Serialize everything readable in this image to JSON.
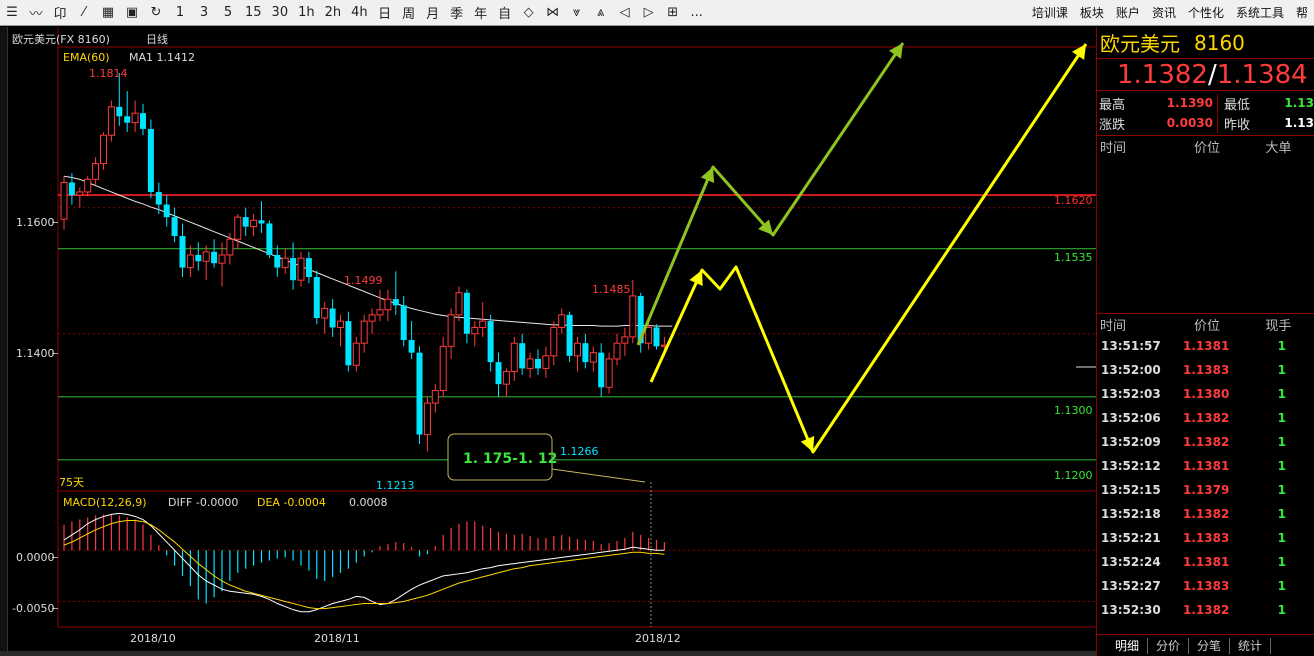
{
  "toolbar": {
    "periods": [
      "1",
      "3",
      "5",
      "15",
      "30",
      "1h",
      "2h",
      "4h",
      "日",
      "周",
      "月",
      "季",
      "年",
      "自"
    ],
    "more": "...",
    "menus": [
      "培训课",
      "板块",
      "账户",
      "资讯",
      "个性化",
      "系统工具",
      "帮"
    ]
  },
  "chart_header": {
    "instrument": "欧元美元(FX 8160)",
    "period": "日线",
    "ema": "EMA(60)",
    "ma1": "MA1 1.1412"
  },
  "macd_header": {
    "name": "MACD(12,26,9)",
    "diff": "DIFF -0.0000",
    "dea": "DEA -0.0004",
    "macd": "0.0008"
  },
  "colors": {
    "up": "#ff3b3b",
    "down": "#00e5ff",
    "ema": "#e8e8e8",
    "support": "#2ea82e",
    "resistance": "#ff2020",
    "arrow_green": "#8fc31f",
    "arrow_yellow": "#ffff00",
    "grid": "#8b0000"
  },
  "chart_data": {
    "type": "candlestick",
    "x_labels": [
      "2018/10",
      "2018/11",
      "2018/12"
    ],
    "y_ticks": [
      "1.1600",
      "1.1400"
    ],
    "macd_ticks": [
      "0.0000",
      "-0.0050"
    ],
    "price_range": [
      1.116,
      1.1855
    ],
    "candles": [
      [
        1.1582,
        1.165,
        1.1565,
        1.164
      ],
      [
        1.164,
        1.1655,
        1.1605,
        1.162
      ],
      [
        1.162,
        1.1632,
        1.16,
        1.1625
      ],
      [
        1.1625,
        1.165,
        1.1618,
        1.1645
      ],
      [
        1.1645,
        1.168,
        1.1635,
        1.167
      ],
      [
        1.167,
        1.172,
        1.166,
        1.1715
      ],
      [
        1.1715,
        1.177,
        1.1705,
        1.176
      ],
      [
        1.176,
        1.1814,
        1.173,
        1.1745
      ],
      [
        1.1745,
        1.1785,
        1.172,
        1.1735
      ],
      [
        1.1735,
        1.177,
        1.172,
        1.175
      ],
      [
        1.175,
        1.1765,
        1.1715,
        1.1725
      ],
      [
        1.1725,
        1.174,
        1.1615,
        1.1625
      ],
      [
        1.1625,
        1.164,
        1.159,
        1.1605
      ],
      [
        1.1605,
        1.162,
        1.157,
        1.1585
      ],
      [
        1.1585,
        1.16,
        1.1545,
        1.1555
      ],
      [
        1.1555,
        1.1575,
        1.149,
        1.1505
      ],
      [
        1.1505,
        1.154,
        1.149,
        1.1525
      ],
      [
        1.1525,
        1.1545,
        1.15,
        1.1515
      ],
      [
        1.1515,
        1.154,
        1.1485,
        1.153
      ],
      [
        1.153,
        1.155,
        1.1505,
        1.1512
      ],
      [
        1.1512,
        1.1545,
        1.1475,
        1.1525
      ],
      [
        1.1525,
        1.156,
        1.151,
        1.155
      ],
      [
        1.155,
        1.159,
        1.1535,
        1.1585
      ],
      [
        1.1585,
        1.16,
        1.1555,
        1.157
      ],
      [
        1.157,
        1.159,
        1.1555,
        1.158
      ],
      [
        1.158,
        1.161,
        1.156,
        1.1575
      ],
      [
        1.1575,
        1.158,
        1.152,
        1.1525
      ],
      [
        1.1525,
        1.154,
        1.149,
        1.1505
      ],
      [
        1.1505,
        1.1535,
        1.1495,
        1.152
      ],
      [
        1.152,
        1.1545,
        1.147,
        1.1485
      ],
      [
        1.1485,
        1.153,
        1.1475,
        1.152
      ],
      [
        1.152,
        1.153,
        1.148,
        1.149
      ],
      [
        1.149,
        1.15,
        1.1415,
        1.1425
      ],
      [
        1.1425,
        1.145,
        1.14,
        1.144
      ],
      [
        1.144,
        1.1455,
        1.1395,
        1.141
      ],
      [
        1.141,
        1.143,
        1.138,
        1.142
      ],
      [
        1.142,
        1.1435,
        1.134,
        1.135
      ],
      [
        1.135,
        1.1395,
        1.134,
        1.1385
      ],
      [
        1.1385,
        1.143,
        1.137,
        1.142
      ],
      [
        1.142,
        1.144,
        1.14,
        1.143
      ],
      [
        1.143,
        1.147,
        1.142,
        1.1438
      ],
      [
        1.1438,
        1.147,
        1.142,
        1.1455
      ],
      [
        1.1455,
        1.1499,
        1.143,
        1.1445
      ],
      [
        1.1445,
        1.146,
        1.138,
        1.139
      ],
      [
        1.139,
        1.142,
        1.136,
        1.137
      ],
      [
        1.137,
        1.138,
        1.1225,
        1.124
      ],
      [
        1.124,
        1.13,
        1.1213,
        1.129
      ],
      [
        1.129,
        1.132,
        1.1275,
        1.131
      ],
      [
        1.131,
        1.1395,
        1.13,
        1.138
      ],
      [
        1.138,
        1.144,
        1.136,
        1.143
      ],
      [
        1.143,
        1.1475,
        1.142,
        1.1465
      ],
      [
        1.1465,
        1.147,
        1.1385,
        1.14
      ],
      [
        1.14,
        1.142,
        1.138,
        1.141
      ],
      [
        1.141,
        1.145,
        1.1395,
        1.142
      ],
      [
        1.142,
        1.143,
        1.134,
        1.1355
      ],
      [
        1.1355,
        1.137,
        1.13,
        1.132
      ],
      [
        1.132,
        1.1345,
        1.13,
        1.134
      ],
      [
        1.134,
        1.1395,
        1.1325,
        1.1385
      ],
      [
        1.1385,
        1.14,
        1.1335,
        1.1345
      ],
      [
        1.1345,
        1.137,
        1.133,
        1.136
      ],
      [
        1.136,
        1.1375,
        1.1335,
        1.1345
      ],
      [
        1.1345,
        1.138,
        1.133,
        1.1365
      ],
      [
        1.1365,
        1.142,
        1.135,
        1.141
      ],
      [
        1.141,
        1.144,
        1.14,
        1.143
      ],
      [
        1.143,
        1.1435,
        1.1355,
        1.1365
      ],
      [
        1.1365,
        1.1395,
        1.134,
        1.1385
      ],
      [
        1.1385,
        1.14,
        1.1345,
        1.1355
      ],
      [
        1.1355,
        1.138,
        1.134,
        1.137
      ],
      [
        1.137,
        1.1385,
        1.13,
        1.1315
      ],
      [
        1.1315,
        1.137,
        1.1305,
        1.136
      ],
      [
        1.136,
        1.14,
        1.135,
        1.1385
      ],
      [
        1.1385,
        1.141,
        1.1365,
        1.1395
      ],
      [
        1.1395,
        1.1485,
        1.1385,
        1.146
      ],
      [
        1.146,
        1.1465,
        1.137,
        1.1385
      ],
      [
        1.1385,
        1.142,
        1.1375,
        1.141
      ],
      [
        1.141,
        1.1415,
        1.1375,
        1.138
      ],
      [
        1.138,
        1.1395,
        1.1365,
        1.1382
      ]
    ],
    "ema": [
      1.165,
      1.1648,
      1.1645,
      1.164,
      1.1635,
      1.163,
      1.1625,
      1.162,
      1.1615,
      1.161,
      1.1606,
      1.1601,
      1.1597,
      1.1592,
      1.1587,
      1.1582,
      1.1577,
      1.1572,
      1.1567,
      1.1562,
      1.1557,
      1.1552,
      1.1547,
      1.1542,
      1.1537,
      1.1532,
      1.1527,
      1.1522,
      1.1517,
      1.1512,
      1.1507,
      1.1502,
      1.1497,
      1.1492,
      1.1487,
      1.1482,
      1.1477,
      1.1472,
      1.1467,
      1.1462,
      1.1457,
      1.1452,
      1.1448,
      1.1444,
      1.144,
      1.1437,
      1.1434,
      1.1431,
      1.1429,
      1.1427,
      1.1426,
      1.1425,
      1.1424,
      1.1423,
      1.1422,
      1.1421,
      1.142,
      1.1419,
      1.1418,
      1.1417,
      1.1416,
      1.1415,
      1.1414,
      1.1414,
      1.1413,
      1.1413,
      1.1413,
      1.1413,
      1.1412,
      1.1412,
      1.1412,
      1.1413,
      1.1413,
      1.1413,
      1.1413,
      1.1412,
      1.1412,
      1.1412
    ],
    "levels": [
      {
        "value": 1.162,
        "label": "1.1620",
        "kind": "resistance"
      },
      {
        "value": 1.1535,
        "label": "1.1535",
        "kind": "support"
      },
      {
        "value": 1.13,
        "label": "1.1300",
        "kind": "support"
      },
      {
        "value": 1.12,
        "label": "1.1200",
        "kind": "support"
      }
    ],
    "annotations": {
      "high": "1.1814",
      "mid_high": "1.1499",
      "recent_high": "1.1485",
      "low": "1.1213",
      "recent_low": "1.1266",
      "range_box": "1. 175-1. 12",
      "days": "75天"
    },
    "macd_hist": [
      0.0025,
      0.0028,
      0.003,
      0.0032,
      0.0034,
      0.0035,
      0.0035,
      0.0034,
      0.0032,
      0.003,
      0.0025,
      0.0015,
      0.0005,
      -0.0005,
      -0.0015,
      -0.0025,
      -0.0035,
      -0.0048,
      -0.0052,
      -0.0046,
      -0.004,
      -0.003,
      -0.0022,
      -0.0018,
      -0.0015,
      -0.0012,
      -0.001,
      -0.0008,
      -0.0007,
      -0.001,
      -0.0015,
      -0.002,
      -0.0028,
      -0.003,
      -0.0026,
      -0.0022,
      -0.0018,
      -0.0012,
      -0.0006,
      -0.0002,
      0.0004,
      0.0006,
      0.0008,
      0.0007,
      0.0003,
      -0.0006,
      -0.0004,
      0.0004,
      0.0015,
      0.0022,
      0.0026,
      0.0028,
      0.0028,
      0.0024,
      0.0022,
      0.0018,
      0.0016,
      0.0015,
      0.0016,
      0.0014,
      0.0012,
      0.0012,
      0.0014,
      0.0015,
      0.0013,
      0.0011,
      0.001,
      0.0009,
      0.0006,
      0.0007,
      0.0009,
      0.0012,
      0.0018,
      0.0015,
      0.0012,
      0.001,
      0.0008
    ],
    "macd_diff": [
      0.001,
      0.0015,
      0.002,
      0.0026,
      0.003,
      0.0033,
      0.0035,
      0.0036,
      0.0035,
      0.0033,
      0.003,
      0.0024,
      0.0016,
      0.0008,
      0.0,
      -0.0008,
      -0.0016,
      -0.0024,
      -0.003,
      -0.0034,
      -0.0038,
      -0.004,
      -0.0041,
      -0.0042,
      -0.0043,
      -0.0045,
      -0.0048,
      -0.0052,
      -0.0055,
      -0.0058,
      -0.006,
      -0.006,
      -0.0058,
      -0.0055,
      -0.0052,
      -0.005,
      -0.0048,
      -0.0045,
      -0.0046,
      -0.005,
      -0.0053,
      -0.0052,
      -0.0048,
      -0.0043,
      -0.0038,
      -0.0034,
      -0.0031,
      -0.0028,
      -0.0025,
      -0.0024,
      -0.0023,
      -0.0022,
      -0.002,
      -0.0018,
      -0.0017,
      -0.0015,
      -0.0014,
      -0.0013,
      -0.0012,
      -0.0011,
      -0.001,
      -0.0009,
      -0.0008,
      -0.0007,
      -0.0006,
      -0.0005,
      -0.0004,
      -0.0003,
      -0.0002,
      -0.0001,
      0.0,
      0.0001,
      0.0003,
      0.0002,
      0.0001,
      0.0,
      0.0
    ],
    "macd_dea": [
      0.0005,
      0.0008,
      0.0012,
      0.0016,
      0.002,
      0.0023,
      0.0026,
      0.0028,
      0.0029,
      0.0029,
      0.0028,
      0.0025,
      0.002,
      0.0014,
      0.0008,
      0.0001,
      -0.0006,
      -0.0013,
      -0.0019,
      -0.0025,
      -0.003,
      -0.0034,
      -0.0037,
      -0.004,
      -0.0042,
      -0.0044,
      -0.0046,
      -0.0048,
      -0.005,
      -0.0052,
      -0.0054,
      -0.0056,
      -0.0057,
      -0.0057,
      -0.0056,
      -0.0055,
      -0.0054,
      -0.0053,
      -0.0052,
      -0.0052,
      -0.0052,
      -0.0052,
      -0.0051,
      -0.005,
      -0.0048,
      -0.0046,
      -0.0044,
      -0.0041,
      -0.0038,
      -0.0035,
      -0.0032,
      -0.003,
      -0.0028,
      -0.0026,
      -0.0024,
      -0.0022,
      -0.002,
      -0.0018,
      -0.0017,
      -0.0015,
      -0.0014,
      -0.0013,
      -0.0012,
      -0.0011,
      -0.001,
      -0.0009,
      -0.0008,
      -0.0007,
      -0.0006,
      -0.0005,
      -0.0004,
      -0.0003,
      -0.0002,
      -0.0002,
      -0.0003,
      -0.0003,
      -0.0004
    ]
  },
  "panel": {
    "title": "欧元美元",
    "code": "8160",
    "bid": "1.1382",
    "sep": "/",
    "ask": "1.1384",
    "stats": [
      {
        "label": "最高",
        "value": "1.1390",
        "label2": "最低",
        "value2": "1.13"
      },
      {
        "label": "涨跌",
        "value": "0.0030",
        "label2": "昨收",
        "value2": "1.13"
      }
    ],
    "sec1_headers": [
      "时间",
      "价位",
      "大单"
    ],
    "sec2_headers": [
      "时间",
      "价位",
      "现手"
    ],
    "ticks": [
      {
        "time": "13:51:57",
        "price": "1.1381",
        "qty": "1"
      },
      {
        "time": "13:52:00",
        "price": "1.1383",
        "qty": "1"
      },
      {
        "time": "13:52:03",
        "price": "1.1380",
        "qty": "1"
      },
      {
        "time": "13:52:06",
        "price": "1.1382",
        "qty": "1"
      },
      {
        "time": "13:52:09",
        "price": "1.1382",
        "qty": "1"
      },
      {
        "time": "13:52:12",
        "price": "1.1381",
        "qty": "1"
      },
      {
        "time": "13:52:15",
        "price": "1.1379",
        "qty": "1"
      },
      {
        "time": "13:52:18",
        "price": "1.1382",
        "qty": "1"
      },
      {
        "time": "13:52:21",
        "price": "1.1383",
        "qty": "1"
      },
      {
        "time": "13:52:24",
        "price": "1.1381",
        "qty": "1"
      },
      {
        "time": "13:52:27",
        "price": "1.1383",
        "qty": "1"
      },
      {
        "time": "13:52:30",
        "price": "1.1382",
        "qty": "1"
      }
    ],
    "tabs": [
      "明细",
      "分价",
      "分笔",
      "统计"
    ]
  }
}
